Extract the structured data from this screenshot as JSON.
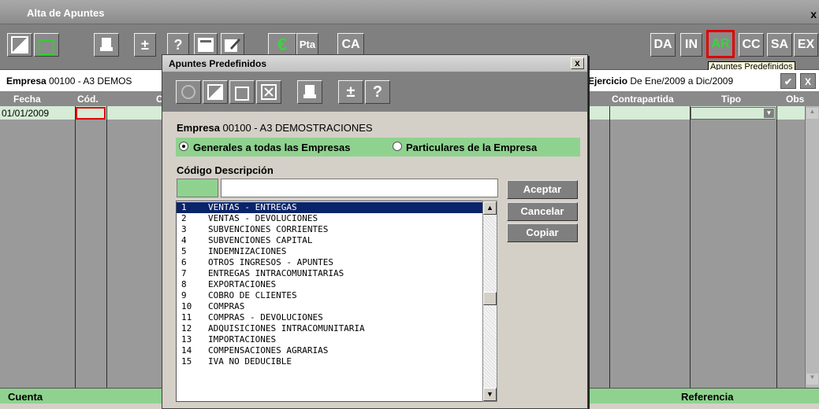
{
  "window": {
    "title": "Alta de Apuntes",
    "close": "x"
  },
  "toolbar": {
    "plusminus": "±",
    "help": "?",
    "euro": "€",
    "pta": "Pta",
    "ca": "CA",
    "right_buttons": [
      "DA",
      "IN",
      "AR",
      "CC",
      "SA",
      "EX"
    ],
    "active_button": "AR",
    "tooltip": "Apuntes Predefinidos"
  },
  "infobar": {
    "empresa_label": "Empresa",
    "empresa_value": "00100 - A3 DEMOS",
    "ejercicio_label": "Ejercicio",
    "ejercicio_value": "De Ene/2009 a Dic/2009",
    "ok": "✔",
    "cancel": "X"
  },
  "grid": {
    "headers": [
      "Fecha",
      "Cód.",
      "C",
      "Contrapartida",
      "Tipo",
      "Obs"
    ],
    "first_date": "01/01/2009",
    "footer_left": "Cuenta",
    "footer_right": "Referencia"
  },
  "dialog": {
    "title": "Apuntes Predefinidos",
    "close": "x",
    "empresa_label": "Empresa",
    "empresa_value": "00100   -   A3 DEMOSTRACIONES",
    "radio_general": "Generales a todas las Empresas",
    "radio_particular": "Particulares de la Empresa",
    "codigo_label": "Código Descripción",
    "buttons": {
      "aceptar": "Aceptar",
      "cancelar": "Cancelar",
      "copiar": "Copiar"
    },
    "items": [
      {
        "n": "1",
        "d": "VENTAS - ENTREGAS"
      },
      {
        "n": "2",
        "d": "VENTAS - DEVOLUCIONES"
      },
      {
        "n": "3",
        "d": "SUBVENCIONES CORRIENTES"
      },
      {
        "n": "4",
        "d": "SUBVENCIONES CAPITAL"
      },
      {
        "n": "5",
        "d": "INDEMNIZACIONES"
      },
      {
        "n": "6",
        "d": "OTROS INGRESOS - APUNTES"
      },
      {
        "n": "7",
        "d": "ENTREGAS INTRACOMUNITARIAS"
      },
      {
        "n": "8",
        "d": "EXPORTACIONES"
      },
      {
        "n": "9",
        "d": "COBRO DE CLIENTES"
      },
      {
        "n": "10",
        "d": "COMPRAS"
      },
      {
        "n": "11",
        "d": "COMPRAS - DEVOLUCIONES"
      },
      {
        "n": "12",
        "d": "ADQUISICIONES INTRACOMUNITARIA"
      },
      {
        "n": "13",
        "d": "IMPORTACIONES"
      },
      {
        "n": "14",
        "d": "COMPENSACIONES AGRARIAS"
      },
      {
        "n": "15",
        "d": "IVA NO DEDUCIBLE"
      }
    ]
  }
}
